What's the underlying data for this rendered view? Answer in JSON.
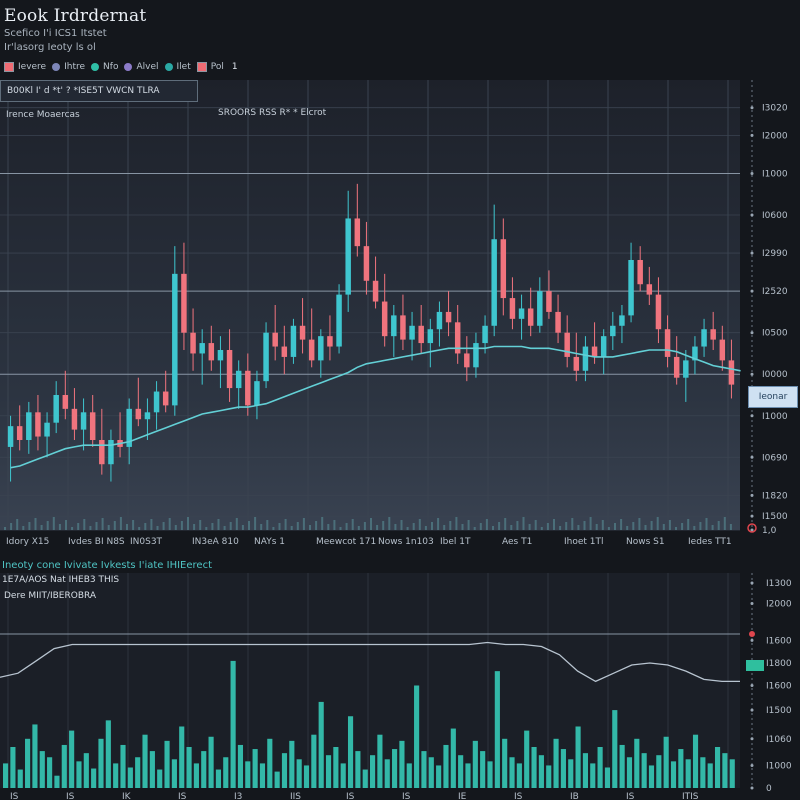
{
  "header": {
    "title": "Eook Irdrdernat",
    "sub1": "Scefico I'i ICS1 Itstet",
    "sub2": "Ir'lasorg   Ieoty ls ol"
  },
  "legend": {
    "items": [
      {
        "label": "Ievere",
        "color": "#ef6b73",
        "shape": "square"
      },
      {
        "label": "Ihtre",
        "color": "#7d86b8",
        "shape": "dot"
      },
      {
        "label": "Nfo",
        "color": "#2fbfa6",
        "shape": "dot"
      },
      {
        "label": "Alvel",
        "color": "#8c7bc9",
        "shape": "dot"
      },
      {
        "label": "Ilet",
        "color": "#2aa9a4",
        "shape": "dot"
      },
      {
        "label": "Pol",
        "color": "#ef6b73",
        "shape": "square"
      }
    ],
    "tail": "1"
  },
  "price_panel": {
    "ticker_text": "B00Kl  I' d   *t'  ? *ISE5T  VWCN  TLRA",
    "label_left": "Irence Moaercas",
    "label_center": "SROORS  RSS  R*  *  Elcrot",
    "last_price_label": "Ieonar",
    "status_marker": "0"
  },
  "volume_panel": {
    "title": "Ineoty cone Ivivate Ivkests I'iate IHIEerect",
    "line1": "1E7A/AOS Nat IHEB3 THIS",
    "line2": "Dere MIIT/IBEROBRA",
    "marker": "0"
  },
  "colors": {
    "up": "#3fc6cf",
    "down": "#f0747e",
    "ma": "#63d0d6",
    "volume": "#33b8a8",
    "grid": "#3a4350"
  },
  "chart_data": [
    {
      "type": "candlestick",
      "title": "",
      "ylim": [
        0,
        13000
      ],
      "y_ticks": [
        "I3020",
        "I2000",
        "I1000",
        "I0600",
        "I2990",
        "I2520",
        "I0500",
        "I0000",
        "I1000",
        "I0690",
        "I1820",
        "I1500",
        "1,0"
      ],
      "y_tick_values": [
        12200,
        11400,
        10300,
        9100,
        8000,
        6900,
        5700,
        4500,
        3300,
        2100,
        1000,
        400,
        0
      ],
      "x_ticks": [
        "Idory X15",
        "Ivdes BI N8S",
        "IN0S3T",
        "IN3eA 810",
        "NAYs 1",
        "Meewcot 171",
        "Nows 1n103",
        "Ibel 1T",
        "Aes T1",
        "Ihoet 1Tl",
        "Nows S1",
        "Iedes TT1"
      ],
      "candles": [
        {
          "o": 2400,
          "h": 3300,
          "l": 1400,
          "c": 3000
        },
        {
          "o": 3000,
          "h": 3600,
          "l": 2300,
          "c": 2600
        },
        {
          "o": 2600,
          "h": 3700,
          "l": 2200,
          "c": 3400
        },
        {
          "o": 3400,
          "h": 3900,
          "l": 2300,
          "c": 2700
        },
        {
          "o": 2700,
          "h": 3400,
          "l": 2100,
          "c": 3100
        },
        {
          "o": 3100,
          "h": 4300,
          "l": 2800,
          "c": 3900
        },
        {
          "o": 3900,
          "h": 4600,
          "l": 3200,
          "c": 3500
        },
        {
          "o": 3500,
          "h": 4100,
          "l": 2600,
          "c": 2900
        },
        {
          "o": 2900,
          "h": 3800,
          "l": 2300,
          "c": 3400
        },
        {
          "o": 3400,
          "h": 3900,
          "l": 2400,
          "c": 2600
        },
        {
          "o": 2600,
          "h": 3500,
          "l": 1600,
          "c": 1900
        },
        {
          "o": 1900,
          "h": 2900,
          "l": 1400,
          "c": 2600
        },
        {
          "o": 2600,
          "h": 3400,
          "l": 2100,
          "c": 2400
        },
        {
          "o": 2400,
          "h": 3800,
          "l": 1900,
          "c": 3500
        },
        {
          "o": 3500,
          "h": 4400,
          "l": 3000,
          "c": 3200
        },
        {
          "o": 3200,
          "h": 3800,
          "l": 2600,
          "c": 3400
        },
        {
          "o": 3400,
          "h": 4300,
          "l": 2900,
          "c": 4000
        },
        {
          "o": 4000,
          "h": 4600,
          "l": 3400,
          "c": 3600
        },
        {
          "o": 3600,
          "h": 8200,
          "l": 3300,
          "c": 7400
        },
        {
          "o": 7400,
          "h": 8300,
          "l": 5200,
          "c": 5700
        },
        {
          "o": 5700,
          "h": 6400,
          "l": 4600,
          "c": 5100
        },
        {
          "o": 5100,
          "h": 5800,
          "l": 4200,
          "c": 5400
        },
        {
          "o": 5400,
          "h": 5900,
          "l": 4600,
          "c": 4900
        },
        {
          "o": 4900,
          "h": 5600,
          "l": 4100,
          "c": 5200
        },
        {
          "o": 5200,
          "h": 5800,
          "l": 3700,
          "c": 4100
        },
        {
          "o": 4100,
          "h": 4900,
          "l": 3500,
          "c": 4600
        },
        {
          "o": 4600,
          "h": 5100,
          "l": 3300,
          "c": 3600
        },
        {
          "o": 3600,
          "h": 4600,
          "l": 3200,
          "c": 4300
        },
        {
          "o": 4300,
          "h": 6000,
          "l": 4100,
          "c": 5700
        },
        {
          "o": 5700,
          "h": 6500,
          "l": 4900,
          "c": 5300
        },
        {
          "o": 5300,
          "h": 5900,
          "l": 4500,
          "c": 5000
        },
        {
          "o": 5000,
          "h": 6100,
          "l": 4800,
          "c": 5900
        },
        {
          "o": 5900,
          "h": 6700,
          "l": 5100,
          "c": 5500
        },
        {
          "o": 5500,
          "h": 6400,
          "l": 4700,
          "c": 4900
        },
        {
          "o": 4900,
          "h": 5800,
          "l": 4400,
          "c": 5600
        },
        {
          "o": 5600,
          "h": 6200,
          "l": 4900,
          "c": 5300
        },
        {
          "o": 5300,
          "h": 7100,
          "l": 5100,
          "c": 6800
        },
        {
          "o": 6800,
          "h": 9800,
          "l": 6300,
          "c": 9000
        },
        {
          "o": 9000,
          "h": 10000,
          "l": 7900,
          "c": 8200
        },
        {
          "o": 8200,
          "h": 8900,
          "l": 6800,
          "c": 7200
        },
        {
          "o": 7200,
          "h": 7900,
          "l": 6400,
          "c": 6600
        },
        {
          "o": 6600,
          "h": 7400,
          "l": 5300,
          "c": 5600
        },
        {
          "o": 5600,
          "h": 6500,
          "l": 5000,
          "c": 6200
        },
        {
          "o": 6200,
          "h": 6800,
          "l": 5200,
          "c": 5500
        },
        {
          "o": 5500,
          "h": 6300,
          "l": 4900,
          "c": 5900
        },
        {
          "o": 5900,
          "h": 6500,
          "l": 5100,
          "c": 5400
        },
        {
          "o": 5400,
          "h": 6100,
          "l": 4700,
          "c": 5800
        },
        {
          "o": 5800,
          "h": 6600,
          "l": 5300,
          "c": 6300
        },
        {
          "o": 6300,
          "h": 6900,
          "l": 5600,
          "c": 6000
        },
        {
          "o": 6000,
          "h": 6500,
          "l": 4800,
          "c": 5100
        },
        {
          "o": 5100,
          "h": 5600,
          "l": 4300,
          "c": 4700
        },
        {
          "o": 4700,
          "h": 5700,
          "l": 4400,
          "c": 5400
        },
        {
          "o": 5400,
          "h": 6200,
          "l": 5100,
          "c": 5900
        },
        {
          "o": 5900,
          "h": 9400,
          "l": 5600,
          "c": 8400
        },
        {
          "o": 8400,
          "h": 9000,
          "l": 6200,
          "c": 6700
        },
        {
          "o": 6700,
          "h": 7300,
          "l": 5800,
          "c": 6100
        },
        {
          "o": 6100,
          "h": 6800,
          "l": 5500,
          "c": 6400
        },
        {
          "o": 6400,
          "h": 7000,
          "l": 5600,
          "c": 5900
        },
        {
          "o": 5900,
          "h": 7300,
          "l": 5700,
          "c": 6900
        },
        {
          "o": 6900,
          "h": 7500,
          "l": 6100,
          "c": 6300
        },
        {
          "o": 6300,
          "h": 6800,
          "l": 5400,
          "c": 5700
        },
        {
          "o": 5700,
          "h": 6200,
          "l": 4700,
          "c": 5000
        },
        {
          "o": 5000,
          "h": 5700,
          "l": 4300,
          "c": 4600
        },
        {
          "o": 4600,
          "h": 5600,
          "l": 4300,
          "c": 5300
        },
        {
          "o": 5300,
          "h": 6000,
          "l": 4800,
          "c": 5000
        },
        {
          "o": 5000,
          "h": 5800,
          "l": 4500,
          "c": 5600
        },
        {
          "o": 5600,
          "h": 6300,
          "l": 5200,
          "c": 5900
        },
        {
          "o": 5900,
          "h": 6500,
          "l": 5400,
          "c": 6200
        },
        {
          "o": 6200,
          "h": 8300,
          "l": 6000,
          "c": 7800
        },
        {
          "o": 7800,
          "h": 8200,
          "l": 6900,
          "c": 7100
        },
        {
          "o": 7100,
          "h": 7600,
          "l": 6500,
          "c": 6800
        },
        {
          "o": 6800,
          "h": 7300,
          "l": 5400,
          "c": 5800
        },
        {
          "o": 5800,
          "h": 6200,
          "l": 4700,
          "c": 5000
        },
        {
          "o": 5000,
          "h": 5600,
          "l": 4200,
          "c": 4400
        },
        {
          "o": 4400,
          "h": 5200,
          "l": 3700,
          "c": 4900
        },
        {
          "o": 4900,
          "h": 5600,
          "l": 4500,
          "c": 5300
        },
        {
          "o": 5300,
          "h": 6100,
          "l": 5000,
          "c": 5800
        },
        {
          "o": 5800,
          "h": 6300,
          "l": 5200,
          "c": 5500
        },
        {
          "o": 5500,
          "h": 5900,
          "l": 4600,
          "c": 4900
        },
        {
          "o": 4900,
          "h": 5500,
          "l": 3800,
          "c": 4200
        }
      ],
      "moving_average": [
        1800,
        1850,
        1950,
        2050,
        2150,
        2250,
        2350,
        2400,
        2450,
        2450,
        2450,
        2450,
        2500,
        2550,
        2650,
        2750,
        2850,
        2950,
        3050,
        3150,
        3250,
        3350,
        3400,
        3450,
        3500,
        3550,
        3550,
        3600,
        3650,
        3750,
        3850,
        3950,
        4050,
        4150,
        4250,
        4350,
        4450,
        4550,
        4700,
        4800,
        4850,
        4900,
        4950,
        5000,
        5050,
        5100,
        5150,
        5200,
        5250,
        5250,
        5250,
        5250,
        5250,
        5300,
        5300,
        5300,
        5300,
        5250,
        5250,
        5250,
        5200,
        5150,
        5100,
        5050,
        5000,
        5000,
        5000,
        5050,
        5100,
        5150,
        5200,
        5200,
        5200,
        5150,
        5050,
        4950,
        4850,
        4750,
        4700,
        4650,
        4600
      ],
      "reference_lines": [
        10300,
        6900,
        4500
      ]
    },
    {
      "type": "bar",
      "title": "",
      "ylim": [
        0,
        1000
      ],
      "y_ticks": [
        "I1300",
        "I2000",
        "I1600",
        "I1800",
        "I1600",
        "I1500",
        "I1060",
        "I1000",
        "0"
      ],
      "y_tick_values": [
        1000,
        900,
        720,
        610,
        500,
        380,
        240,
        110,
        0
      ],
      "x_ticks": [
        "IS",
        "IS",
        "IK",
        "IS",
        "I3",
        "IIS",
        "IS",
        "IS",
        "IE",
        "IS",
        "IB",
        "IS",
        "ITIS"
      ],
      "values": [
        120,
        200,
        90,
        240,
        310,
        180,
        150,
        60,
        210,
        280,
        130,
        170,
        95,
        240,
        330,
        120,
        210,
        100,
        150,
        260,
        180,
        90,
        230,
        140,
        300,
        200,
        120,
        180,
        250,
        90,
        150,
        620,
        210,
        130,
        190,
        120,
        240,
        80,
        170,
        230,
        140,
        110,
        260,
        420,
        160,
        200,
        120,
        350,
        180,
        90,
        160,
        260,
        140,
        190,
        230,
        120,
        500,
        180,
        150,
        110,
        210,
        290,
        160,
        120,
        230,
        180,
        130,
        570,
        240,
        150,
        120,
        280,
        200,
        160,
        110,
        240,
        190,
        140,
        300,
        170,
        120,
        200,
        100,
        380,
        210,
        150,
        240,
        170,
        110,
        160,
        250,
        130,
        190,
        140,
        260,
        150,
        120,
        200,
        170,
        140
      ],
      "line": [
        540,
        560,
        620,
        680,
        700,
        700,
        700,
        700,
        700,
        700,
        700,
        700,
        700,
        700,
        700,
        700,
        700,
        700,
        700,
        700,
        700,
        700,
        700,
        700,
        700,
        700,
        700,
        710,
        700,
        700,
        690,
        650,
        570,
        520,
        560,
        600,
        610,
        600,
        570,
        530,
        520,
        520
      ]
    }
  ]
}
